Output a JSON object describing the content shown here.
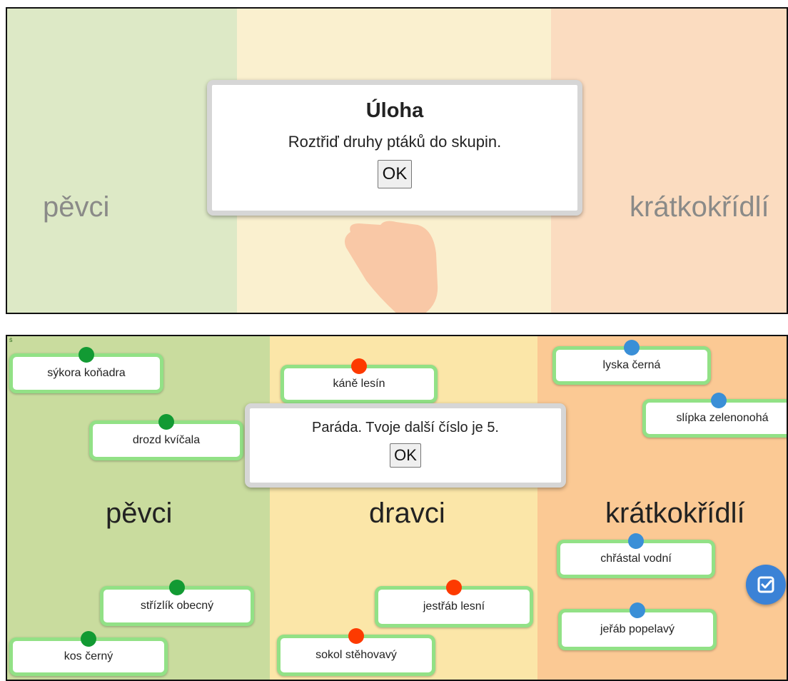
{
  "top_panel": {
    "categories": [
      "pěvci",
      "krátkokřídlí"
    ],
    "dialog": {
      "title": "Úloha",
      "message": "Roztřiď druhy ptáků do skupin.",
      "ok_label": "OK"
    },
    "hand_icon": "pointing-hand-icon"
  },
  "bottom_panel": {
    "corner_mark": "ṡ",
    "categories": [
      "pěvci",
      "dravci",
      "krátkokřídlí"
    ],
    "dialog": {
      "message": "Paráda. Tvoje další číslo je 5.",
      "ok_label": "OK"
    },
    "cards": [
      {
        "label": "sýkora koňadra",
        "group": "pěvci",
        "pin": "green"
      },
      {
        "label": "drozd kvíčala",
        "group": "pěvci",
        "pin": "green"
      },
      {
        "label": "střízlík obecný",
        "group": "pěvci",
        "pin": "green"
      },
      {
        "label": "kos černý",
        "group": "pěvci",
        "pin": "green"
      },
      {
        "label": "káně lesín",
        "group": "dravci",
        "pin": "red"
      },
      {
        "label": "jestřáb lesní",
        "group": "dravci",
        "pin": "red"
      },
      {
        "label": "sokol stěhovavý",
        "group": "dravci",
        "pin": "red"
      },
      {
        "label": "lyska černá",
        "group": "krátkokřídlí",
        "pin": "blue"
      },
      {
        "label": "slípka zelenonohá",
        "group": "krátkokřídlí",
        "pin": "blue"
      },
      {
        "label": "chřástal vodní",
        "group": "krátkokřídlí",
        "pin": "blue"
      },
      {
        "label": "jeřáb popelavý",
        "group": "krátkokřídlí",
        "pin": "blue"
      }
    ],
    "check_button_icon": "check-square-icon"
  },
  "colors": {
    "pin_green": "#129a33",
    "pin_red": "#fd3a00",
    "pin_blue": "#3a8fd7",
    "card_border": "#92e186",
    "check_button": "#3b82d6"
  }
}
